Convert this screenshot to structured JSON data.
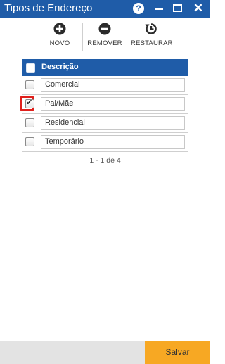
{
  "window": {
    "title": "Tipos de Endereço",
    "help_glyph": "?",
    "close_glyph": "✕"
  },
  "toolbar": {
    "novo_label": "NOVO",
    "remover_label": "REMOVER",
    "restaurar_label": "RESTAURAR"
  },
  "grid": {
    "column_header": "Descrição",
    "rows": [
      {
        "value": "Comercial",
        "checked": false
      },
      {
        "value": "Pai/Mãe",
        "checked": true
      },
      {
        "value": "Residencial",
        "checked": false
      },
      {
        "value": "Temporário",
        "checked": false
      }
    ]
  },
  "pager": {
    "text": "1 - 1 de 4"
  },
  "footer": {
    "save_label": "Salvar"
  },
  "colors": {
    "titlebar": "#1f5ca8",
    "save_button": "#f7a823",
    "highlight": "#e0201c"
  },
  "icons": [
    "help-icon",
    "minimize-icon",
    "maximize-icon",
    "close-icon",
    "plus-circle-icon",
    "minus-circle-icon",
    "restore-icon"
  ]
}
